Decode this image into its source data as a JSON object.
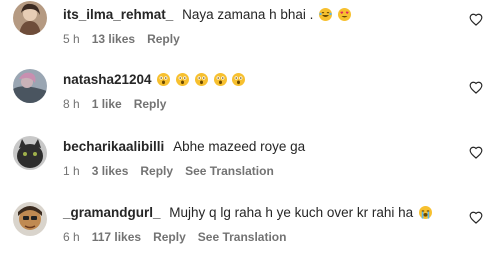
{
  "comments": [
    {
      "username": "its_ilma_rehmat_",
      "text": "Naya zamana h bhai .",
      "emojis": [
        "laughing-emoji",
        "heart-eyes-emoji"
      ],
      "time": "5 h",
      "likes": "13 likes",
      "reply": "Reply",
      "see_translation": ""
    },
    {
      "username": "natasha21204",
      "text": "",
      "emojis": [
        "astonished-emoji",
        "astonished-emoji",
        "astonished-emoji",
        "astonished-emoji",
        "astonished-emoji"
      ],
      "time": "8 h",
      "likes": "1 like",
      "reply": "Reply",
      "see_translation": ""
    },
    {
      "username": "becharikaalibilli",
      "text": "Abhe mazeed roye ga",
      "emojis": [],
      "time": "1 h",
      "likes": "3 likes",
      "reply": "Reply",
      "see_translation": "See Translation"
    },
    {
      "username": "_gramandgurl_",
      "text": "Mujhy q lg raha h ye kuch over kr rahi ha",
      "emojis": [
        "crying-emoji"
      ],
      "time": "6 h",
      "likes": "117 likes",
      "reply": "Reply",
      "see_translation": "See Translation"
    }
  ],
  "colors": {
    "text": "#262626",
    "meta": "#737373",
    "emoji": "#f7c02f"
  }
}
